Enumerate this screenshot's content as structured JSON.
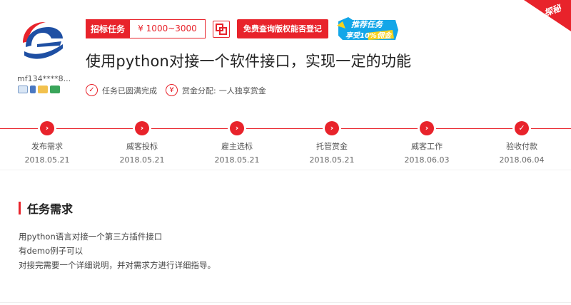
{
  "user": {
    "name": "mf134****8..."
  },
  "task": {
    "type_label": "招标任务",
    "price": "¥ 1000~3000",
    "copyright_button": "免费查询版权能否登记",
    "promo_line1": "推荐任务",
    "promo_line2": "享受10%佣金",
    "corner_label": "探秘",
    "title": "使用python对接一个软件接口，实现一定的功能",
    "status": "任务已圆满完成",
    "reward_label": "赏金分配:",
    "reward_value": "一人独享赏金"
  },
  "steps": [
    {
      "label": "发布需求",
      "date": "2018.05.21",
      "icon": "chevron-right-icon"
    },
    {
      "label": "威客投标",
      "date": "2018.05.21",
      "icon": "chevron-right-icon"
    },
    {
      "label": "雇主选标",
      "date": "2018.05.21",
      "icon": "chevron-right-icon"
    },
    {
      "label": "托管赏金",
      "date": "2018.05.21",
      "icon": "chevron-right-icon"
    },
    {
      "label": "威客工作",
      "date": "2018.06.03",
      "icon": "chevron-right-icon"
    },
    {
      "label": "验收付款",
      "date": "2018.06.04",
      "icon": "check-icon"
    }
  ],
  "section": {
    "title": "任务需求",
    "lines": [
      "用python语言对接一个第三方插件接口",
      "有demo例子可以",
      "对接完需要一个详细说明，并对需求方进行详细指导。"
    ]
  },
  "colors": {
    "accent": "#e8232b",
    "promo": "#13a6e8",
    "logo_blue": "#1e4fa3"
  }
}
